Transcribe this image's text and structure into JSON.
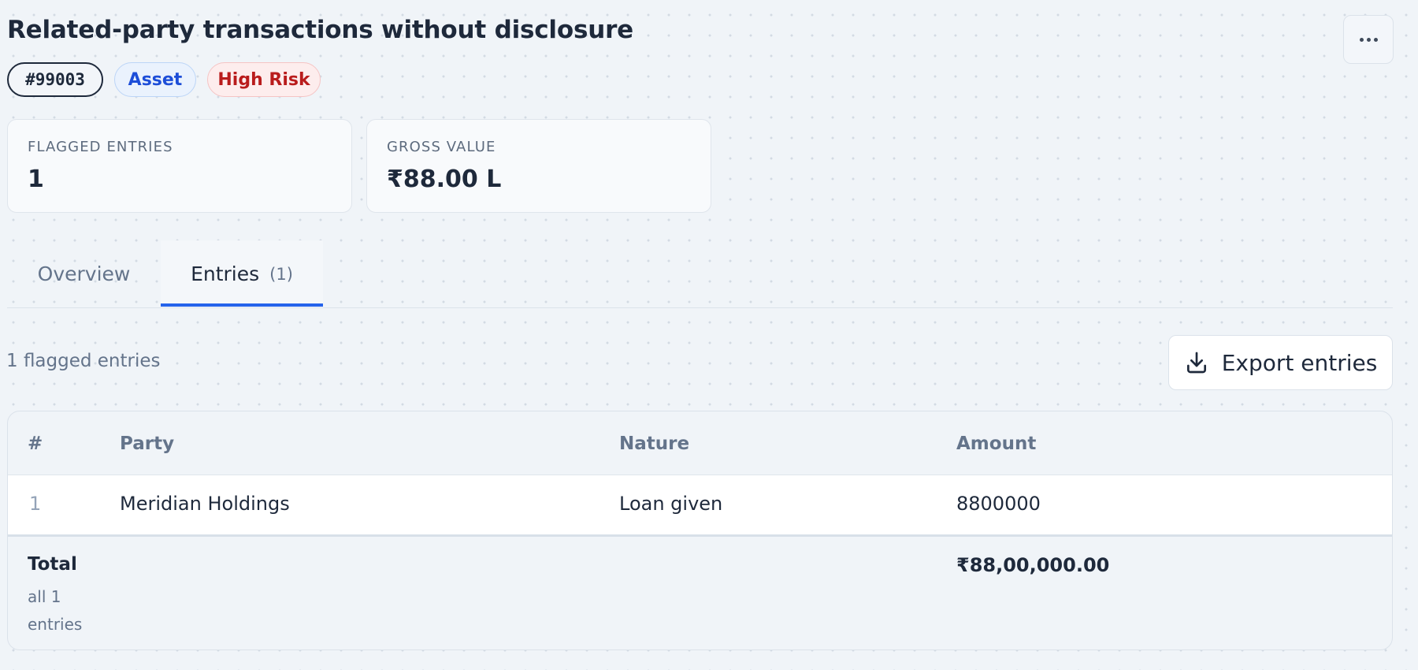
{
  "header": {
    "title": "Related-party transactions without disclosure",
    "more_menu_icon": "more-horizontal-icon"
  },
  "badges": {
    "id": "#99003",
    "category": "Asset",
    "risk": "High Risk"
  },
  "stats": [
    {
      "label": "FLAGGED ENTRIES",
      "value": "1"
    },
    {
      "label": "GROSS VALUE",
      "value": "₹88.00 L"
    }
  ],
  "tabs": [
    {
      "label": "Overview"
    },
    {
      "label": "Entries",
      "count": "(1)"
    }
  ],
  "active_tab": "Entries",
  "entries": {
    "summary": "1 flagged entries",
    "export_label": "Export entries",
    "export_icon": "download-icon"
  },
  "table": {
    "columns": [
      "#",
      "Party",
      "Nature",
      "Amount"
    ],
    "rows": [
      {
        "index": "1",
        "party": "Meridian Holdings",
        "nature": "Loan given",
        "amount": "8800000"
      }
    ],
    "total": {
      "label": "Total",
      "sublabel": "all 1 entries",
      "value": "₹88,00,000.00"
    }
  },
  "colors": {
    "accent": "#2563eb",
    "asset_badge": "#1d4ed8",
    "risk_badge": "#b91c1c"
  }
}
